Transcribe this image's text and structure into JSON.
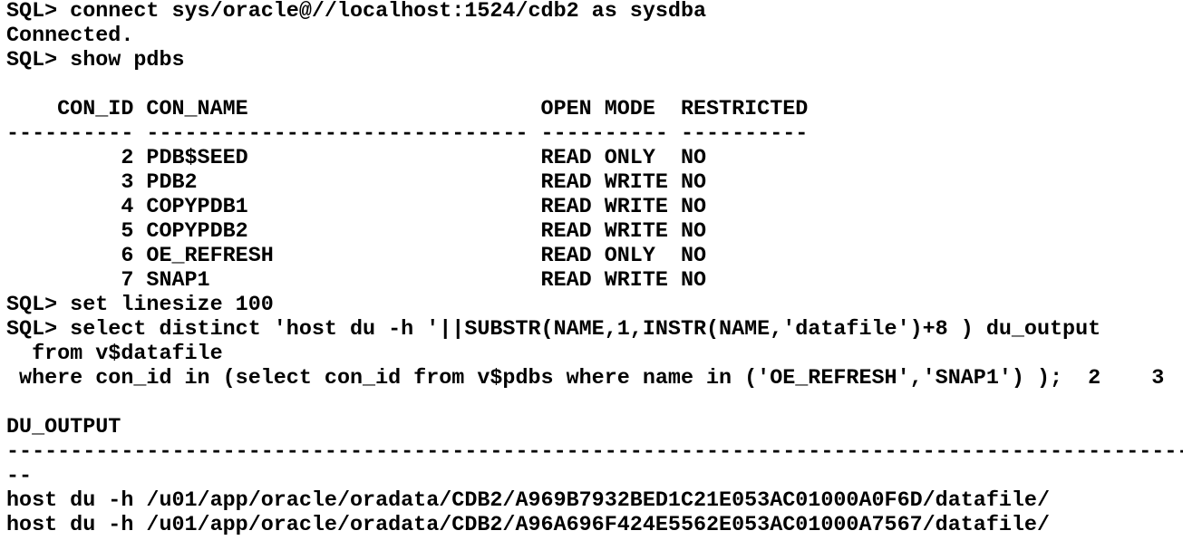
{
  "terminal": {
    "lines": [
      "SQL> connect sys/oracle@//localhost:1524/cdb2 as sysdba",
      "Connected.",
      "SQL> show pdbs",
      "",
      "    CON_ID CON_NAME                       OPEN MODE  RESTRICTED",
      "---------- ------------------------------ ---------- ----------",
      "         2 PDB$SEED                       READ ONLY  NO",
      "         3 PDB2                           READ WRITE NO",
      "         4 COPYPDB1                       READ WRITE NO",
      "         5 COPYPDB2                       READ WRITE NO",
      "         6 OE_REFRESH                     READ ONLY  NO",
      "         7 SNAP1                          READ WRITE NO",
      "SQL> set linesize 100",
      "SQL> select distinct 'host du -h '||SUBSTR(NAME,1,INSTR(NAME,'datafile')+8 ) du_output",
      "  from v$datafile",
      " where con_id in (select con_id from v$pdbs where name in ('OE_REFRESH','SNAP1') );  2    3",
      "",
      "DU_OUTPUT",
      "----------------------------------------------------------------------------------------------------",
      "--",
      "host du -h /u01/app/oracle/oradata/CDB2/A969B7932BED1C21E053AC01000A0F6D/datafile/",
      "host du -h /u01/app/oracle/oradata/CDB2/A96A696F424E5562E053AC01000A7567/datafile/"
    ]
  }
}
